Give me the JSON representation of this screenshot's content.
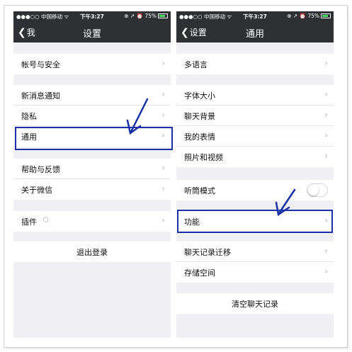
{
  "status_bar": {
    "carrier": "●●●○○ 中国移动 ᯤ",
    "time": "下午3:27",
    "battery_text": "⊕ ↗ ⏰ 75%"
  },
  "left_screen": {
    "back_label": "我",
    "title": "设置",
    "items": [
      {
        "label": "帐号与安全"
      },
      {
        "label": "新消息通知"
      },
      {
        "label": "隐私"
      },
      {
        "label": "通用"
      },
      {
        "label": "帮助与反馈"
      },
      {
        "label": "关于微信"
      },
      {
        "label": "插件"
      }
    ],
    "logout_label": "退出登录"
  },
  "right_screen": {
    "back_label": "设置",
    "title": "通用",
    "items": [
      {
        "label": "多语言"
      },
      {
        "label": "字体大小"
      },
      {
        "label": "聊天背景"
      },
      {
        "label": "我的表情"
      },
      {
        "label": "照片和视频"
      },
      {
        "label": "听筒模式"
      },
      {
        "label": "功能"
      },
      {
        "label": "聊天记录迁移"
      },
      {
        "label": "存储空间"
      }
    ],
    "clear_label": "清空聊天记录"
  },
  "colors": {
    "nav_bg": "#2e3034",
    "page_bg": "#efeff4",
    "highlight": "#1b2fa6"
  },
  "icons": [
    "back-chevron-icon",
    "chevron-right-icon",
    "plugin-icon",
    "battery-icon",
    "annotation-arrow-icon"
  ]
}
